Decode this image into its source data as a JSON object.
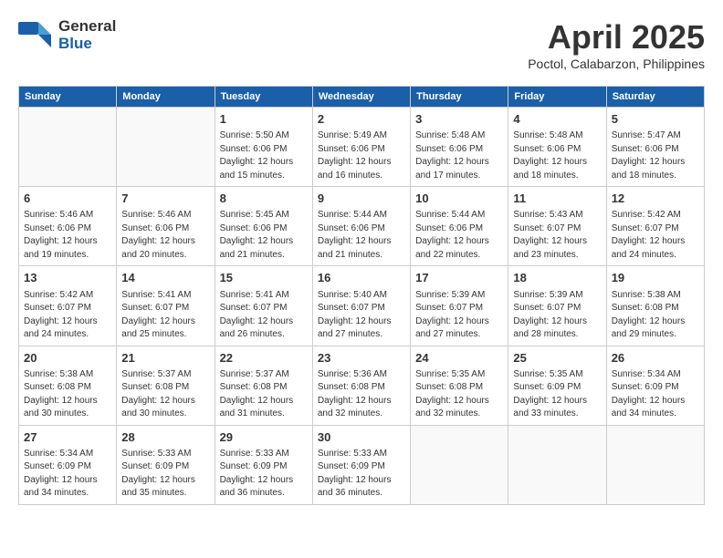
{
  "header": {
    "logo_general": "General",
    "logo_blue": "Blue",
    "month_title": "April 2025",
    "location": "Poctol, Calabarzon, Philippines"
  },
  "days_of_week": [
    "Sunday",
    "Monday",
    "Tuesday",
    "Wednesday",
    "Thursday",
    "Friday",
    "Saturday"
  ],
  "weeks": [
    [
      {
        "day": "",
        "content": ""
      },
      {
        "day": "",
        "content": ""
      },
      {
        "day": "1",
        "content": "Sunrise: 5:50 AM\nSunset: 6:06 PM\nDaylight: 12 hours and 15 minutes."
      },
      {
        "day": "2",
        "content": "Sunrise: 5:49 AM\nSunset: 6:06 PM\nDaylight: 12 hours and 16 minutes."
      },
      {
        "day": "3",
        "content": "Sunrise: 5:48 AM\nSunset: 6:06 PM\nDaylight: 12 hours and 17 minutes."
      },
      {
        "day": "4",
        "content": "Sunrise: 5:48 AM\nSunset: 6:06 PM\nDaylight: 12 hours and 18 minutes."
      },
      {
        "day": "5",
        "content": "Sunrise: 5:47 AM\nSunset: 6:06 PM\nDaylight: 12 hours and 18 minutes."
      }
    ],
    [
      {
        "day": "6",
        "content": "Sunrise: 5:46 AM\nSunset: 6:06 PM\nDaylight: 12 hours and 19 minutes."
      },
      {
        "day": "7",
        "content": "Sunrise: 5:46 AM\nSunset: 6:06 PM\nDaylight: 12 hours and 20 minutes."
      },
      {
        "day": "8",
        "content": "Sunrise: 5:45 AM\nSunset: 6:06 PM\nDaylight: 12 hours and 21 minutes."
      },
      {
        "day": "9",
        "content": "Sunrise: 5:44 AM\nSunset: 6:06 PM\nDaylight: 12 hours and 21 minutes."
      },
      {
        "day": "10",
        "content": "Sunrise: 5:44 AM\nSunset: 6:06 PM\nDaylight: 12 hours and 22 minutes."
      },
      {
        "day": "11",
        "content": "Sunrise: 5:43 AM\nSunset: 6:07 PM\nDaylight: 12 hours and 23 minutes."
      },
      {
        "day": "12",
        "content": "Sunrise: 5:42 AM\nSunset: 6:07 PM\nDaylight: 12 hours and 24 minutes."
      }
    ],
    [
      {
        "day": "13",
        "content": "Sunrise: 5:42 AM\nSunset: 6:07 PM\nDaylight: 12 hours and 24 minutes."
      },
      {
        "day": "14",
        "content": "Sunrise: 5:41 AM\nSunset: 6:07 PM\nDaylight: 12 hours and 25 minutes."
      },
      {
        "day": "15",
        "content": "Sunrise: 5:41 AM\nSunset: 6:07 PM\nDaylight: 12 hours and 26 minutes."
      },
      {
        "day": "16",
        "content": "Sunrise: 5:40 AM\nSunset: 6:07 PM\nDaylight: 12 hours and 27 minutes."
      },
      {
        "day": "17",
        "content": "Sunrise: 5:39 AM\nSunset: 6:07 PM\nDaylight: 12 hours and 27 minutes."
      },
      {
        "day": "18",
        "content": "Sunrise: 5:39 AM\nSunset: 6:07 PM\nDaylight: 12 hours and 28 minutes."
      },
      {
        "day": "19",
        "content": "Sunrise: 5:38 AM\nSunset: 6:08 PM\nDaylight: 12 hours and 29 minutes."
      }
    ],
    [
      {
        "day": "20",
        "content": "Sunrise: 5:38 AM\nSunset: 6:08 PM\nDaylight: 12 hours and 30 minutes."
      },
      {
        "day": "21",
        "content": "Sunrise: 5:37 AM\nSunset: 6:08 PM\nDaylight: 12 hours and 30 minutes."
      },
      {
        "day": "22",
        "content": "Sunrise: 5:37 AM\nSunset: 6:08 PM\nDaylight: 12 hours and 31 minutes."
      },
      {
        "day": "23",
        "content": "Sunrise: 5:36 AM\nSunset: 6:08 PM\nDaylight: 12 hours and 32 minutes."
      },
      {
        "day": "24",
        "content": "Sunrise: 5:35 AM\nSunset: 6:08 PM\nDaylight: 12 hours and 32 minutes."
      },
      {
        "day": "25",
        "content": "Sunrise: 5:35 AM\nSunset: 6:09 PM\nDaylight: 12 hours and 33 minutes."
      },
      {
        "day": "26",
        "content": "Sunrise: 5:34 AM\nSunset: 6:09 PM\nDaylight: 12 hours and 34 minutes."
      }
    ],
    [
      {
        "day": "27",
        "content": "Sunrise: 5:34 AM\nSunset: 6:09 PM\nDaylight: 12 hours and 34 minutes."
      },
      {
        "day": "28",
        "content": "Sunrise: 5:33 AM\nSunset: 6:09 PM\nDaylight: 12 hours and 35 minutes."
      },
      {
        "day": "29",
        "content": "Sunrise: 5:33 AM\nSunset: 6:09 PM\nDaylight: 12 hours and 36 minutes."
      },
      {
        "day": "30",
        "content": "Sunrise: 5:33 AM\nSunset: 6:09 PM\nDaylight: 12 hours and 36 minutes."
      },
      {
        "day": "",
        "content": ""
      },
      {
        "day": "",
        "content": ""
      },
      {
        "day": "",
        "content": ""
      }
    ]
  ]
}
